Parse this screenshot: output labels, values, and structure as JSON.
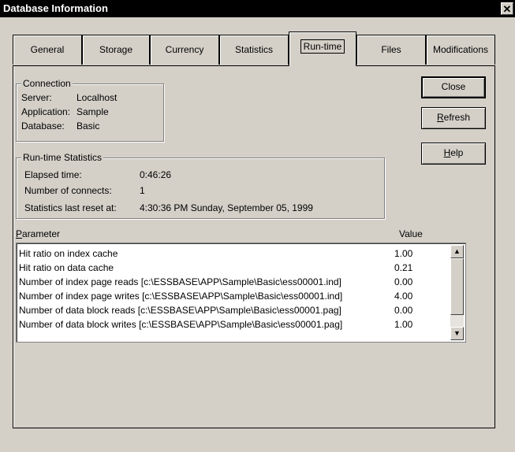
{
  "window": {
    "title": "Database Information",
    "close_glyph": "✕"
  },
  "tabs": [
    {
      "label": "General"
    },
    {
      "label": "Storage"
    },
    {
      "label": "Currency"
    },
    {
      "label": "Statistics"
    },
    {
      "label": "Run-time"
    },
    {
      "label": "Files"
    },
    {
      "label": "Modifications"
    }
  ],
  "active_tab": "Run-time",
  "connection": {
    "group_label": "Connection",
    "server_label": "Server:",
    "server_value": "Localhost",
    "application_label": "Application:",
    "application_value": "Sample",
    "database_label": "Database:",
    "database_value": "Basic"
  },
  "buttons": {
    "close": "Close",
    "refresh_first": "R",
    "refresh_rest": "efresh",
    "help_first": "H",
    "help_rest": "elp"
  },
  "runtime": {
    "group_label": "Run-time Statistics",
    "elapsed_label": "Elapsed time:",
    "elapsed_value": "0:46:26",
    "connects_label": "Number of connects:",
    "connects_value": "1",
    "reset_label": "Statistics last reset at:",
    "reset_value": "4:30:36 PM Sunday, September 05, 1999"
  },
  "list": {
    "param_header_first": "P",
    "param_header_rest": "arameter",
    "value_header": "Value",
    "rows": [
      {
        "parameter": "Hit ratio on index cache",
        "value": "1.00"
      },
      {
        "parameter": "Hit ratio on data cache",
        "value": "0.21"
      },
      {
        "parameter": "Number of index page reads [c:\\ESSBASE\\APP\\Sample\\Basic\\ess00001.ind]",
        "value": "0.00"
      },
      {
        "parameter": "Number of index page writes [c:\\ESSBASE\\APP\\Sample\\Basic\\ess00001.ind]",
        "value": "4.00"
      },
      {
        "parameter": "Number of data block reads [c:\\ESSBASE\\APP\\Sample\\Basic\\ess00001.pag]",
        "value": "0.00"
      },
      {
        "parameter": "Number of data block writes [c:\\ESSBASE\\APP\\Sample\\Basic\\ess00001.pag]",
        "value": "1.00"
      }
    ],
    "scroll_up_glyph": "▲",
    "scroll_down_glyph": "▼"
  }
}
